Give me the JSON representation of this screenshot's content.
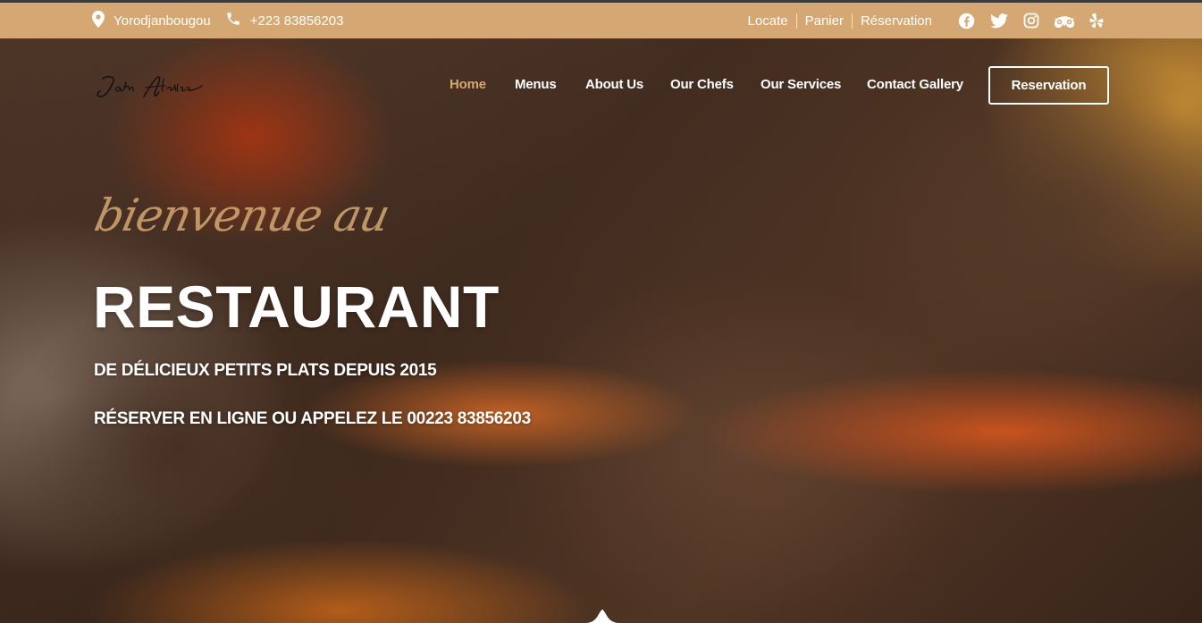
{
  "topbar": {
    "location": "Yorodjanbougou",
    "phone": "+223 83856203",
    "links": [
      "Locate",
      "Panier",
      "Réservation"
    ],
    "socials": [
      "facebook-icon",
      "twitter-icon",
      "instagram-icon",
      "tripadvisor-icon",
      "yelp-icon"
    ],
    "bg_color": "#d5a772"
  },
  "logo": {
    "text": "John Atkins"
  },
  "nav": {
    "items": [
      "Home",
      "Menus",
      "About Us",
      "Our Chefs",
      "Our Services",
      "Contact Gallery"
    ],
    "active": "Home",
    "active_color": "#d5a772",
    "cta": "Reservation"
  },
  "hero": {
    "script_text": "bienvenue au",
    "title": "RESTAURANT",
    "subtitle": "DE DÉLICIEUX PETITS PLATS DEPUIS 2015",
    "call_to_action": "RÉSERVER EN LIGNE OU APPELEZ LE 00223 83856203"
  }
}
